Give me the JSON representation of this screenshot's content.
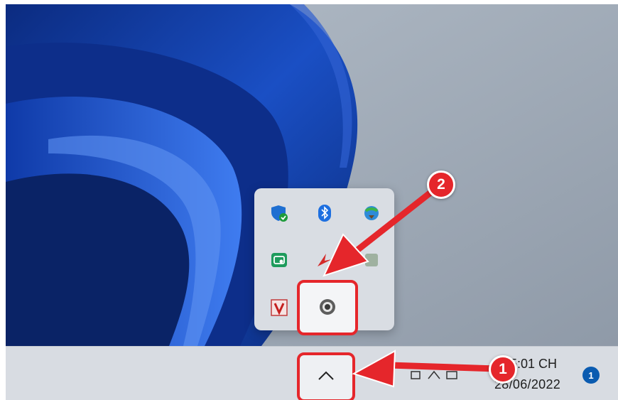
{
  "clock": {
    "time": "15:01 CH",
    "date": "28/06/2022"
  },
  "notifications": {
    "count": "1"
  },
  "annotations": {
    "step1": "1",
    "step2": "2"
  },
  "tray_icons": [
    "windows-security-icon",
    "bluetooth-icon",
    "internet-download-manager-icon",
    "green-app-icon",
    "red-arrow-app-icon",
    "unikey-icon",
    "v-app-icon",
    "webcam-icon"
  ],
  "colors": {
    "accent_red": "#e5262b",
    "badge_blue": "#0a5bb0",
    "taskbar": "#d8dce2"
  }
}
